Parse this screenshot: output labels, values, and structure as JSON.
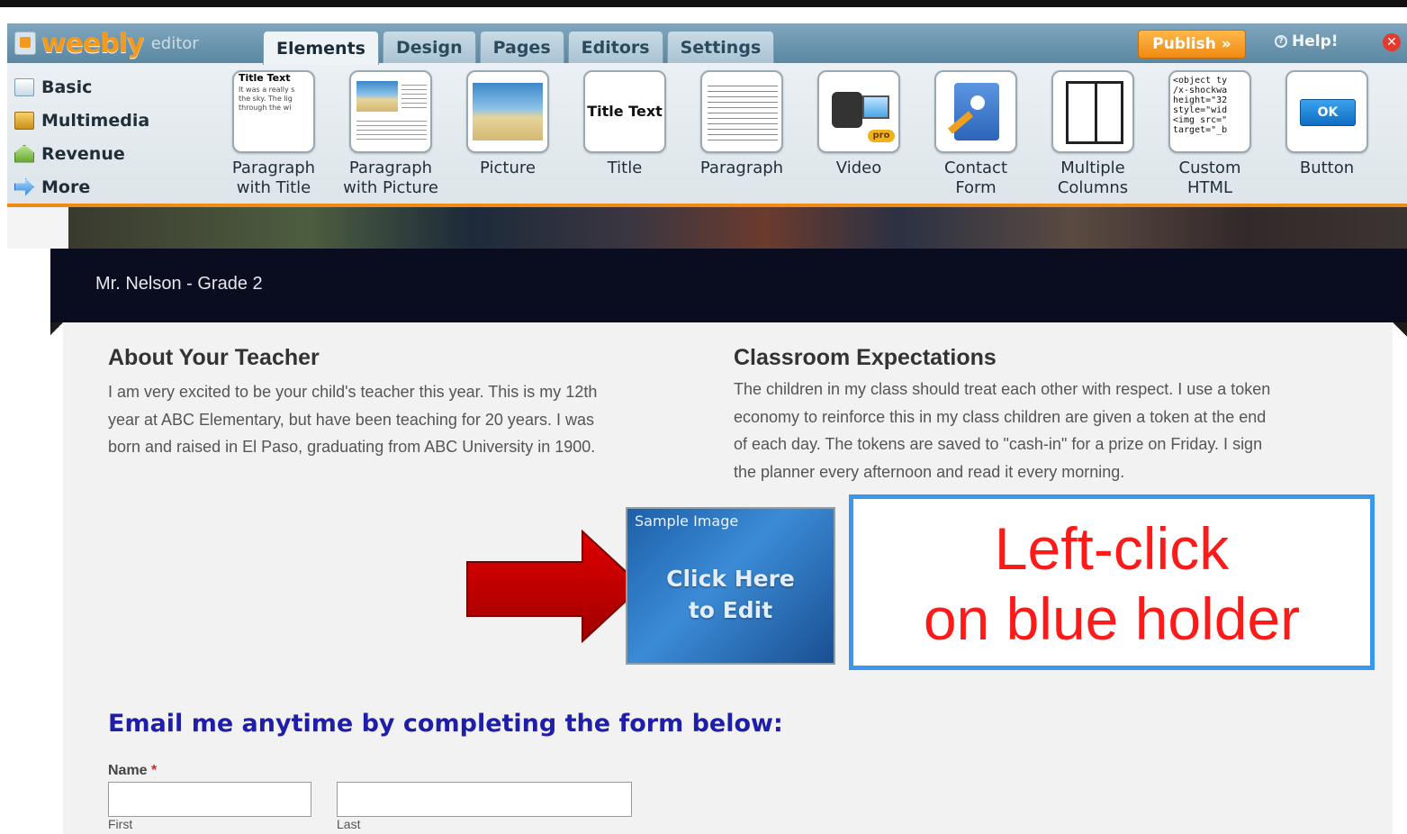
{
  "app": {
    "logo_text": "weebly",
    "logo_sub": "editor",
    "tabs": [
      "Elements",
      "Design",
      "Pages",
      "Editors",
      "Settings"
    ],
    "publish_label": "Publish »",
    "help_label": "Help!",
    "close_label": "✕"
  },
  "sidebar": {
    "items": [
      {
        "label": "Basic",
        "icon": "page-icon"
      },
      {
        "label": "Multimedia",
        "icon": "film-icon"
      },
      {
        "label": "Revenue",
        "icon": "revenue-icon"
      },
      {
        "label": "More",
        "icon": "arrow-right-icon"
      }
    ]
  },
  "elements": {
    "items": [
      {
        "label": "Paragraph with Title",
        "preview_title": "Title Text",
        "preview_text": "It was a really s the sky. The lig through the wi"
      },
      {
        "label": "Paragraph with Picture"
      },
      {
        "label": "Picture"
      },
      {
        "label": "Title",
        "preview_title": "Title Text"
      },
      {
        "label": "Paragraph"
      },
      {
        "label": "Video",
        "preview_badge": "pro"
      },
      {
        "label": "Contact Form"
      },
      {
        "label": "Multiple Columns"
      },
      {
        "label": "Custom HTML",
        "preview_code": "<object ty\n/x-shockwa\nheight=\"32\nstyle=\"wid\n<img src=\"\ntarget=\"_b"
      },
      {
        "label": "Button",
        "preview_button": "OK"
      }
    ]
  },
  "site": {
    "nav_title": "Mr. Nelson - Grade 2",
    "about_heading": "About Your Teacher",
    "about_lines": [
      "I am very excited to be your  child's teacher this year. This is my 12th",
      "year at ABC Elementary, but have been  teaching for 20 years. I was",
      "born and raised in El Paso, graduating from ABC  University in 1900."
    ],
    "expect_heading": "Classroom Expectations",
    "expect_lines": [
      "The children in my class should treat each other with respect. I use a token",
      "economy to reinforce this in my class children are given a token at the end",
      "of each day. The tokens are saved to \"cash-in\" for a prize on Friday. I sign",
      "the planner every afternoon and read it  every morning."
    ],
    "sample_image_label": "Sample Image",
    "sample_image_action_1": "Click Here",
    "sample_image_action_2": "to Edit",
    "email_heading": "Email me anytime by completing the form below:",
    "name_label": "Name",
    "name_required": "*",
    "first_label": "First",
    "last_label": "Last"
  },
  "annotation": {
    "callout_line1": "Left-click",
    "callout_line2": "on blue holder",
    "arrow_color": "#cc0000",
    "callout_border": "#3a97f0",
    "callout_text_color": "#ff1a1a"
  }
}
